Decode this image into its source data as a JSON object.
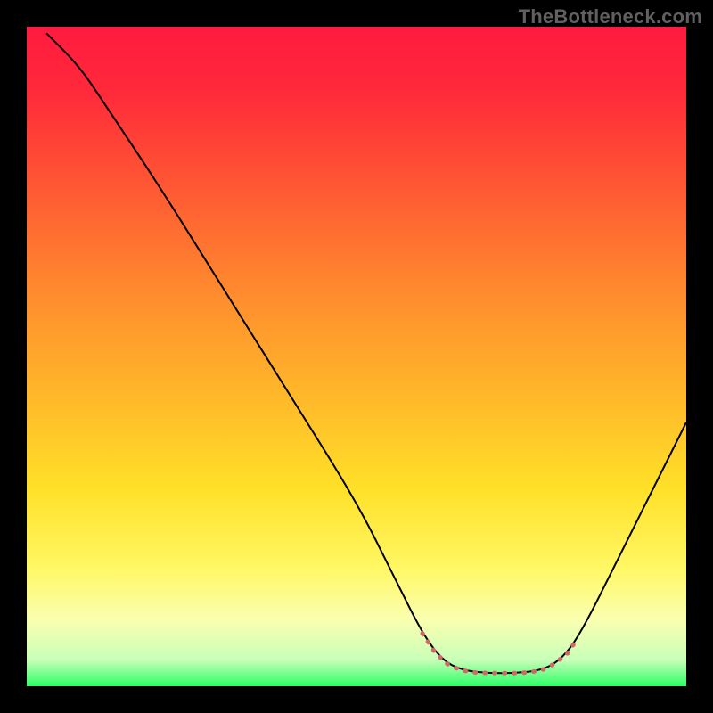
{
  "watermark": "TheBottleneck.com",
  "chart_data": {
    "type": "line",
    "title": "",
    "xlabel": "",
    "ylabel": "",
    "xlim": [
      0,
      100
    ],
    "ylim": [
      0,
      100
    ],
    "background_gradient": {
      "stops": [
        {
          "offset": 0.0,
          "color": "#ff1a3f"
        },
        {
          "offset": 0.1,
          "color": "#ff2a3a"
        },
        {
          "offset": 0.25,
          "color": "#ff5a33"
        },
        {
          "offset": 0.4,
          "color": "#ff8a2e"
        },
        {
          "offset": 0.55,
          "color": "#ffb52a"
        },
        {
          "offset": 0.7,
          "color": "#ffe028"
        },
        {
          "offset": 0.82,
          "color": "#fff764"
        },
        {
          "offset": 0.9,
          "color": "#faffb0"
        },
        {
          "offset": 0.96,
          "color": "#c8ffb8"
        },
        {
          "offset": 1.0,
          "color": "#2cff66"
        }
      ]
    },
    "series": [
      {
        "name": "bottleneck-curve",
        "color": "#000000",
        "width": 2,
        "points": [
          {
            "x": 3,
            "y": 99
          },
          {
            "x": 8,
            "y": 94
          },
          {
            "x": 12,
            "y": 88
          },
          {
            "x": 20,
            "y": 76
          },
          {
            "x": 30,
            "y": 60
          },
          {
            "x": 40,
            "y": 44
          },
          {
            "x": 50,
            "y": 28
          },
          {
            "x": 56,
            "y": 16
          },
          {
            "x": 60,
            "y": 8
          },
          {
            "x": 63,
            "y": 4
          },
          {
            "x": 66,
            "y": 2.4
          },
          {
            "x": 70,
            "y": 2.0
          },
          {
            "x": 74,
            "y": 2.0
          },
          {
            "x": 78,
            "y": 2.4
          },
          {
            "x": 81,
            "y": 4
          },
          {
            "x": 84,
            "y": 8
          },
          {
            "x": 90,
            "y": 20
          },
          {
            "x": 96,
            "y": 32
          },
          {
            "x": 100,
            "y": 40
          }
        ]
      },
      {
        "name": "highlight-dotted",
        "color": "#d06868",
        "width": 5,
        "dash": "1 10",
        "linecap": "round",
        "points": [
          {
            "x": 60,
            "y": 8
          },
          {
            "x": 62,
            "y": 5
          },
          {
            "x": 64,
            "y": 3.2
          },
          {
            "x": 66,
            "y": 2.4
          },
          {
            "x": 68,
            "y": 2.1
          },
          {
            "x": 70,
            "y": 2.0
          },
          {
            "x": 72,
            "y": 2.0
          },
          {
            "x": 74,
            "y": 2.0
          },
          {
            "x": 76,
            "y": 2.1
          },
          {
            "x": 78,
            "y": 2.4
          },
          {
            "x": 80,
            "y": 3.4
          },
          {
            "x": 82,
            "y": 5
          },
          {
            "x": 83,
            "y": 6.5
          }
        ]
      }
    ]
  }
}
